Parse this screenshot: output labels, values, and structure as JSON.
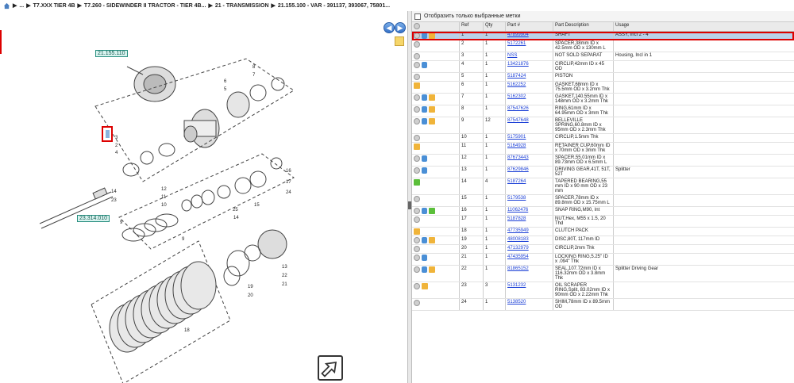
{
  "breadcrumb": {
    "items": [
      "...",
      "T7.XXX TIER 4B",
      "T7.260 - SIDEWINDER II TRACTOR - TIER 4B...",
      "21 - TRANSMISSION",
      "21.155.100 - VAR - 391137, 393067, 75801..."
    ]
  },
  "diagram": {
    "callouts": [
      "21.155.110",
      "23.314.010"
    ],
    "labels": [
      "8",
      "7",
      "6",
      "5",
      "3",
      "2",
      "4",
      "1",
      "14",
      "23",
      "12",
      "11",
      "10",
      "9",
      "25",
      "15",
      "14",
      "24",
      "17",
      "16",
      "13",
      "22",
      "21",
      "20",
      "19",
      "18",
      "9",
      "9",
      "14",
      "15"
    ]
  },
  "filter": {
    "label": "Отобразить только выбранные метки"
  },
  "grid": {
    "headers": {
      "ref": "Ref",
      "qty": "Qty",
      "part": "Part #",
      "desc": "Part Description",
      "usage": "Usage"
    },
    "rows": [
      {
        "icons": [
          "plus",
          "info",
          "box"
        ],
        "ref": "1",
        "qty": "1",
        "part": "47899904",
        "desc": "SHAFT",
        "usage": "ASSY, Incl 2 - 4",
        "selected": true
      },
      {
        "icons": [
          "plus"
        ],
        "ref": "2",
        "qty": "1",
        "part": "5172261",
        "desc": "SPACER,38mm ID x 42.5mm OD x 130mm L",
        "usage": ""
      },
      {
        "icons": [
          "plus"
        ],
        "ref": "3",
        "qty": "1",
        "part": "NSS",
        "desc": "NOT SOLD SEPARAT",
        "usage": "Housing, Incl in 1"
      },
      {
        "icons": [
          "plus",
          "info"
        ],
        "ref": "4",
        "qty": "1",
        "part": "13421876",
        "desc": "CIRCLIP,42mm ID x 45 OD",
        "usage": ""
      },
      {
        "icons": [
          "plus"
        ],
        "ref": "5",
        "qty": "1",
        "part": "5187424",
        "desc": "PISTON",
        "usage": ""
      },
      {
        "icons": [
          "box"
        ],
        "ref": "6",
        "qty": "1",
        "part": "5162252",
        "desc": "GASKET,68mm ID x 75.5mm OD x 3.2mm Thk",
        "usage": ""
      },
      {
        "icons": [
          "plus",
          "info",
          "box"
        ],
        "ref": "7",
        "qty": "1",
        "part": "5162302",
        "desc": "GASKET,140.55mm ID x 148mm OD x 3.2mm Thk",
        "usage": ""
      },
      {
        "icons": [
          "plus",
          "info",
          "box"
        ],
        "ref": "8",
        "qty": "1",
        "part": "87547626",
        "desc": "RING,61mm ID x 64.95mm OD x 3mm Thk",
        "usage": ""
      },
      {
        "icons": [
          "plus",
          "info",
          "box"
        ],
        "ref": "9",
        "qty": "12",
        "part": "87547648",
        "desc": "BELLEVILLE SPRING,60.8mm ID x 95mm OD x 2.3mm Thk",
        "usage": ""
      },
      {
        "icons": [
          "plus"
        ],
        "ref": "10",
        "qty": "1",
        "part": "5175901",
        "desc": "CIRCLIP,1.5mm Thk",
        "usage": ""
      },
      {
        "icons": [
          "box"
        ],
        "ref": "11",
        "qty": "1",
        "part": "5164928",
        "desc": "RETAINER CUP,60mm ID x 70mm OD x 3mm Thk",
        "usage": ""
      },
      {
        "icons": [
          "plus",
          "info"
        ],
        "ref": "12",
        "qty": "1",
        "part": "87673443",
        "desc": "SPACER,55.01mm ID x 89.73mm OD x 6.5mm L",
        "usage": ""
      },
      {
        "icons": [
          "plus",
          "info"
        ],
        "ref": "13",
        "qty": "1",
        "part": "87629846",
        "desc": "DRIVING GEAR,41T, 51T, 52T",
        "usage": "Splitter"
      },
      {
        "icons": [
          "arrow"
        ],
        "ref": "14",
        "qty": "4",
        "part": "5187264",
        "desc": "TAPERED BEARING,55 mm ID x 90 mm OD x 23 mm",
        "usage": ""
      },
      {
        "icons": [
          "plus"
        ],
        "ref": "15",
        "qty": "1",
        "part": "5179538",
        "desc": "SPACER,78mm ID x 89.8mm OD x 15.75mm L",
        "usage": ""
      },
      {
        "icons": [
          "plus",
          "info",
          "arrow"
        ],
        "ref": "16",
        "qty": "1",
        "part": "11062476",
        "desc": "SNAP RING,M90, Int",
        "usage": ""
      },
      {
        "icons": [
          "plus"
        ],
        "ref": "17",
        "qty": "1",
        "part": "5187828",
        "desc": "NUT,Hex, M55 x 1.5, 20 Thd",
        "usage": ""
      },
      {
        "icons": [
          "box"
        ],
        "ref": "18",
        "qty": "1",
        "part": "47735949",
        "desc": "CLUTCH PACK",
        "usage": ""
      },
      {
        "icons": [
          "plus",
          "info",
          "box"
        ],
        "ref": "19",
        "qty": "1",
        "part": "48008183",
        "desc": "DISC,80T, 117mm ID",
        "usage": ""
      },
      {
        "icons": [
          "plus"
        ],
        "ref": "20",
        "qty": "1",
        "part": "47132979",
        "desc": "CIRCLIP,2mm Thk",
        "usage": ""
      },
      {
        "icons": [
          "plus",
          "info"
        ],
        "ref": "21",
        "qty": "1",
        "part": "47435954",
        "desc": "LOCKING RING,5.25\" ID x .094\" Thk",
        "usage": ""
      },
      {
        "icons": [
          "plus",
          "info",
          "box"
        ],
        "ref": "22",
        "qty": "1",
        "part": "81865152",
        "desc": "SEAL,107.72mm ID x 116.32mm OD x 3.8mm Thk",
        "usage": "Splitter Driving Gear"
      },
      {
        "icons": [
          "plus",
          "box"
        ],
        "ref": "23",
        "qty": "3",
        "part": "5131232",
        "desc": "OIL SCRAPER RING,Split, 83.02mm ID x 90mm OD x 2.22mm Thk",
        "usage": ""
      },
      {
        "icons": [
          "plus"
        ],
        "ref": "24",
        "qty": "1",
        "part": "5138520",
        "desc": "SHIM,78mm ID x 89.5mm OD",
        "usage": ""
      }
    ]
  }
}
